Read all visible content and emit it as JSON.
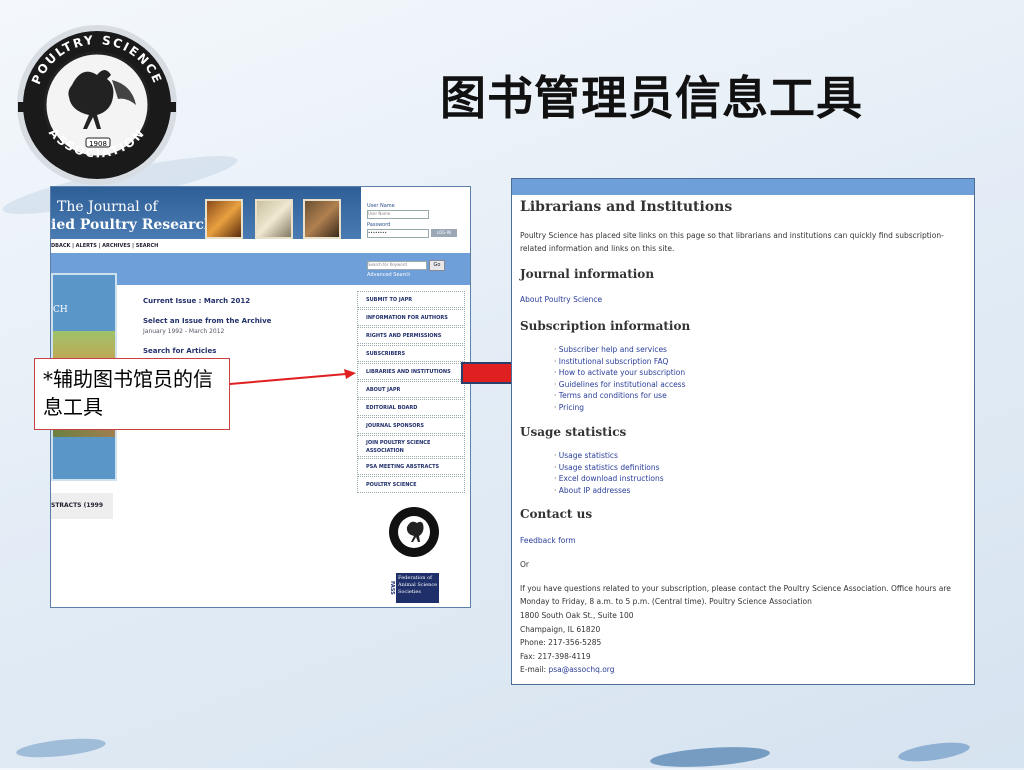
{
  "slide": {
    "title": "图书管理员信息工具",
    "logo": {
      "name": "poultry-science-association-seal",
      "text_top": "POULTRY SCIENCE",
      "text_bottom": "ASSOCIATION",
      "year": "1908"
    },
    "callout": "*辅助图书馆员的信息工具"
  },
  "left_screenshot": {
    "journal_title_line1": "The Journal of",
    "journal_title_line2": "ied Poultry Research",
    "nav_links": "DBACK | ALERTS | ARCHIVES | SEARCH",
    "login": {
      "user_name_label": "User Name",
      "user_name_placeholder": "User Name",
      "password_label": "Password",
      "password_value": "••••••••",
      "login_button": "LOG-IN"
    },
    "search": {
      "placeholder": "Search for Keyword",
      "go_button": "Go",
      "advanced": "Advanced Search"
    },
    "cover_text": "CH",
    "main_links": [
      {
        "label": "Current Issue : March 2012"
      },
      {
        "label": "Select an Issue from the Archive",
        "sub": "January 1992 - March 2012"
      },
      {
        "label": "Search for Articles"
      }
    ],
    "side_menu": [
      "SUBMIT TO JAPR",
      "INFORMATION FOR AUTHORS",
      "RIGHTS AND PERMISSIONS",
      "SUBSCRIBERS",
      "LIBRARIES AND INSTITUTIONS",
      "ABOUT JAPR",
      "EDITORIAL BOARD",
      "JOURNAL SPONSORS",
      "JOIN POULTRY SCIENCE ASSOCIATION",
      "PSA MEETING ABSTRACTS",
      "POULTRY SCIENCE"
    ],
    "abstracts_tab": "STRACTS (1999",
    "fass_logo_text": "Federation of Animal Science Societies",
    "fass_letters": "FASS"
  },
  "right_screenshot": {
    "heading": "Librarians and Institutions",
    "intro": "Poultry Science has placed site links on this page so that librarians and institutions can quickly find subscription-related information and links on this site.",
    "journal_heading": "Journal information",
    "journal_link": "About Poultry Science",
    "subscription_heading": "Subscription information",
    "subscription_links": [
      "Subscriber help and services",
      "Institutional subscription FAQ",
      "How to activate your subscription",
      "Guidelines for institutional access",
      "Terms and conditions for use",
      "Pricing"
    ],
    "usage_heading": "Usage statistics",
    "usage_links": [
      "Usage statistics",
      "Usage statistics definitions",
      "Excel download instructions",
      "About IP addresses"
    ],
    "contact_heading": "Contact us",
    "feedback_link": "Feedback form",
    "or_text": "Or",
    "contact_text": "If you have questions related to your subscription, please contact the Poultry Science Association. Office hours are Monday to Friday, 8 a.m. to 5 p.m. (Central time). Poultry Science Association",
    "address1": "1800 South Oak St., Suite 100",
    "address2": "Champaign, IL 61820",
    "phone": "Phone: 217-356-5285",
    "fax": "Fax: 217-398-4119",
    "email_label": "E-mail: ",
    "email": "psa@assochq.org"
  },
  "colors": {
    "accent_blue": "#6f9fd8",
    "arrow_red": "#e02020",
    "link": "#2a3f9a"
  }
}
